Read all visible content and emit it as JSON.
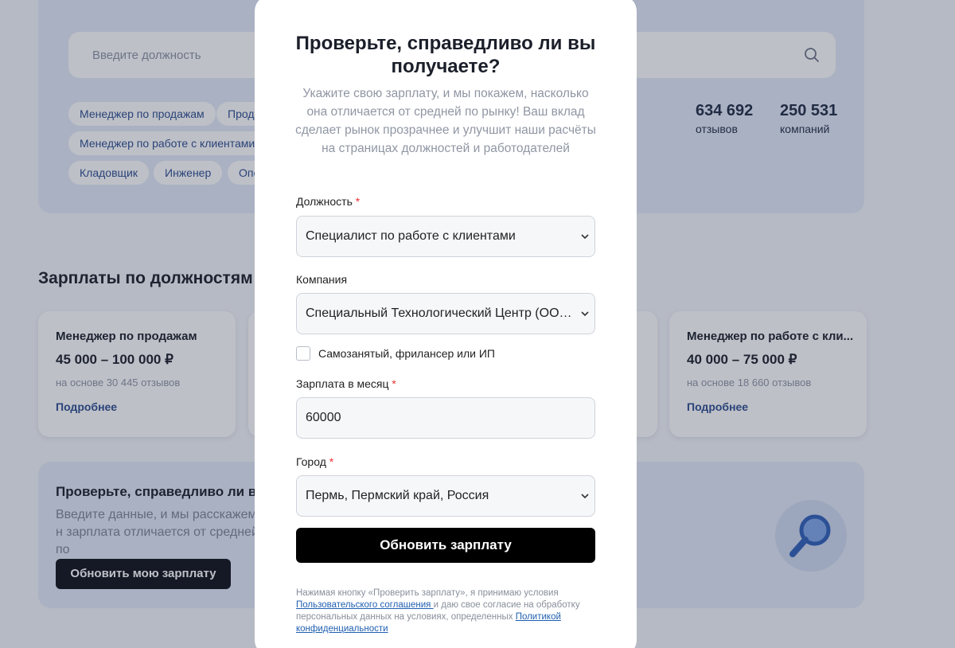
{
  "search": {
    "placeholder": "Введите должность"
  },
  "tags": [
    "Менеджер по продажам",
    "Прода",
    "Менеджер по работе с клиентами",
    "Кладовщик",
    "Инженер",
    "Опе"
  ],
  "stats": [
    {
      "number": "634 692",
      "label": "отзывов"
    },
    {
      "number": "250 531",
      "label": "компаний"
    }
  ],
  "salaries": {
    "title": "Зарплаты по должностям",
    "cards": [
      {
        "title": "Менеджер по продажам",
        "range": "45 000 – 100 000 ₽",
        "note": "на основе 30 445 отзывов",
        "link": "Подробнее"
      },
      {
        "title": "Менеджер по работе с кли...",
        "range": "40 000 – 75 000 ₽",
        "note": "на основе 18 660 отзывов",
        "link": "Подробнее"
      }
    ]
  },
  "check_panel": {
    "title": "Проверьте, справедливо ли вы",
    "desc": "Введите данные, и мы расскажем, н зарплата отличается от средней по",
    "button": "Обновить мою зарплату"
  },
  "modal": {
    "title": "Проверьте, справедливо ли вы получаете?",
    "desc": "Укажите свою зарплату, и мы покажем, насколько она отличается от средней по рынку! Ваш вклад сделает рынок прозрачнее и улучшит наши расчёты на страницах должностей и работодателей",
    "position_label": "Должность",
    "position_value": "Специалист по работе с клиентами",
    "company_label": "Компания",
    "company_value": "Специальный Технологический Центр (ООО С...",
    "self_employed_label": "Самозанятый, фрилансер или ИП",
    "salary_label": "Зарплата в месяц",
    "salary_value": "60000",
    "city_label": "Город",
    "city_value": "Пермь, Пермский край, Россия",
    "submit": "Обновить зарплату",
    "legal_1": "Нажимая кнопку «Проверить зарплату», я принимаю условия ",
    "legal_link_1": "Пользовательского соглашения ",
    "legal_2": "и даю свое согласие на обработку персональных данных на условиях, определенных ",
    "legal_link_2": "Политикой конфиденциальности",
    "required_mark": "*"
  },
  "colors": {
    "accent_link": "#2a4d8f",
    "button": "#000000",
    "required": "#e33333"
  },
  "icons": [
    "search-icon",
    "chevron-down-icon",
    "magnifier-icon"
  ]
}
